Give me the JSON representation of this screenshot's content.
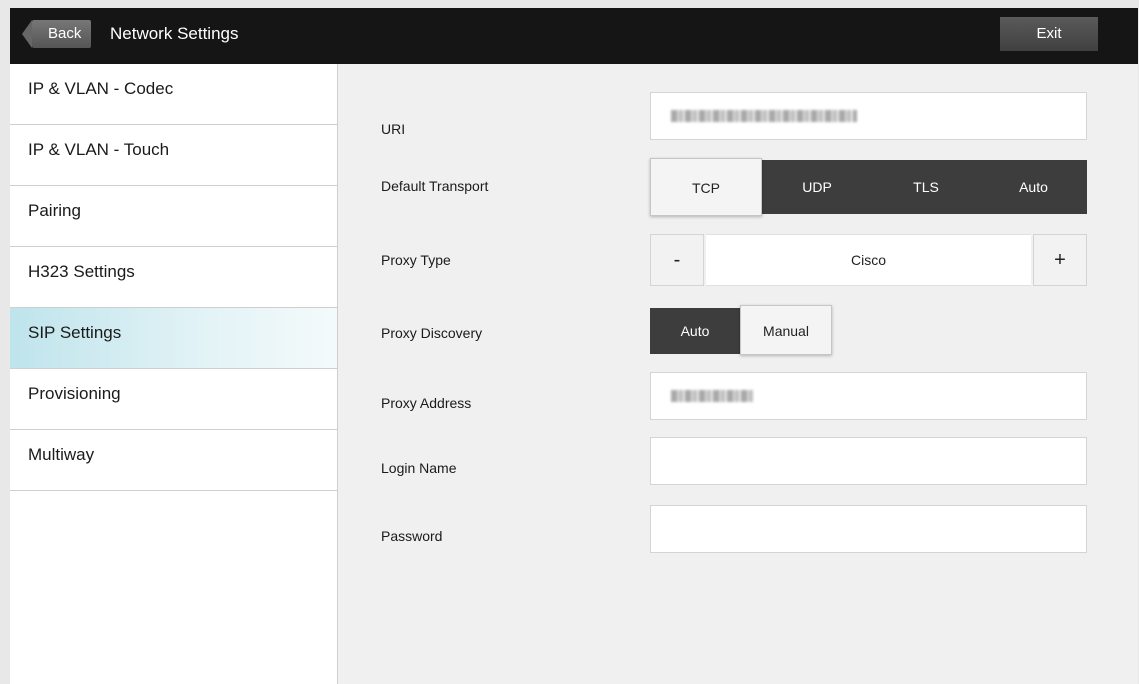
{
  "header": {
    "back_label": "Back",
    "title": "Network Settings",
    "exit_label": "Exit"
  },
  "sidebar": {
    "items": [
      {
        "label": "IP & VLAN - Codec"
      },
      {
        "label": "IP & VLAN - Touch"
      },
      {
        "label": "Pairing"
      },
      {
        "label": "H323 Settings"
      },
      {
        "label": "SIP Settings",
        "active": true
      },
      {
        "label": "Provisioning"
      },
      {
        "label": "Multiway"
      }
    ]
  },
  "form": {
    "uri": {
      "label": "URI",
      "value_redacted": true
    },
    "default_transport": {
      "label": "Default Transport",
      "options": [
        "TCP",
        "UDP",
        "TLS",
        "Auto"
      ],
      "selected": "TCP"
    },
    "proxy_type": {
      "label": "Proxy Type",
      "value": "Cisco",
      "decrement": "-",
      "increment": "+"
    },
    "proxy_discovery": {
      "label": "Proxy Discovery",
      "options": [
        "Auto",
        "Manual"
      ],
      "selected": "Manual"
    },
    "proxy_address": {
      "label": "Proxy Address",
      "value_redacted": true
    },
    "login_name": {
      "label": "Login Name",
      "value": ""
    },
    "password": {
      "label": "Password",
      "value": ""
    }
  },
  "colors": {
    "header_bg": "#151515",
    "active_item": "#bfe4ec",
    "segment_dark": "#3d3d3d"
  }
}
